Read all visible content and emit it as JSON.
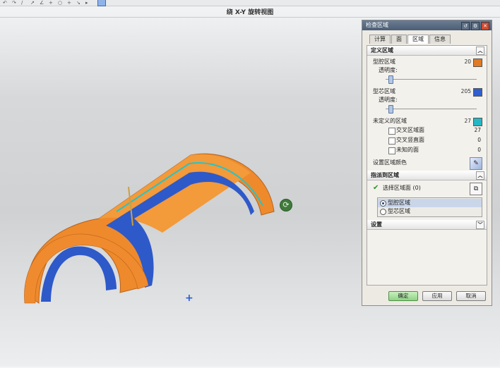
{
  "toolbar": {
    "icons": [
      "undo-icon",
      "redo-icon",
      "curve-icon",
      "arrow-icon",
      "snap-icon",
      "point-icon",
      "circle-icon",
      "plus-icon",
      "arrow-icon",
      "select-icon",
      "view-cube-icon"
    ]
  },
  "view": {
    "title": "绕 X-Y 旋转视图"
  },
  "dialog": {
    "title": "检查区域",
    "tabs": [
      "计算",
      "面",
      "区域",
      "信息"
    ],
    "active_tab": "区域",
    "sections": {
      "define": {
        "header": "定义区域",
        "cavity": {
          "label": "型腔区域",
          "count": "20",
          "color": "#e07a24"
        },
        "transparency_label_1": "透明度:",
        "core": {
          "label": "型芯区域",
          "count": "205",
          "color": "#2f5fd0"
        },
        "transparency_label_2": "透明度:",
        "undefined": {
          "label": "未定义的区域",
          "count": "27",
          "color": "#26b7c4"
        },
        "sub_items": [
          {
            "label": "交叉区域面",
            "count": "27"
          },
          {
            "label": "交叉竖直面",
            "count": "0"
          },
          {
            "label": "未知的面",
            "count": "0"
          }
        ],
        "colors_label": "设置区域颜色"
      },
      "assign": {
        "header": "指派到区域",
        "select_label": "选择区域面 (0)",
        "options": [
          "型腔区域",
          "型芯区域"
        ],
        "selected": "型腔区域"
      },
      "settings": {
        "header": "设置"
      }
    },
    "buttons": {
      "ok": "确定",
      "apply": "应用",
      "cancel": "取消"
    }
  }
}
